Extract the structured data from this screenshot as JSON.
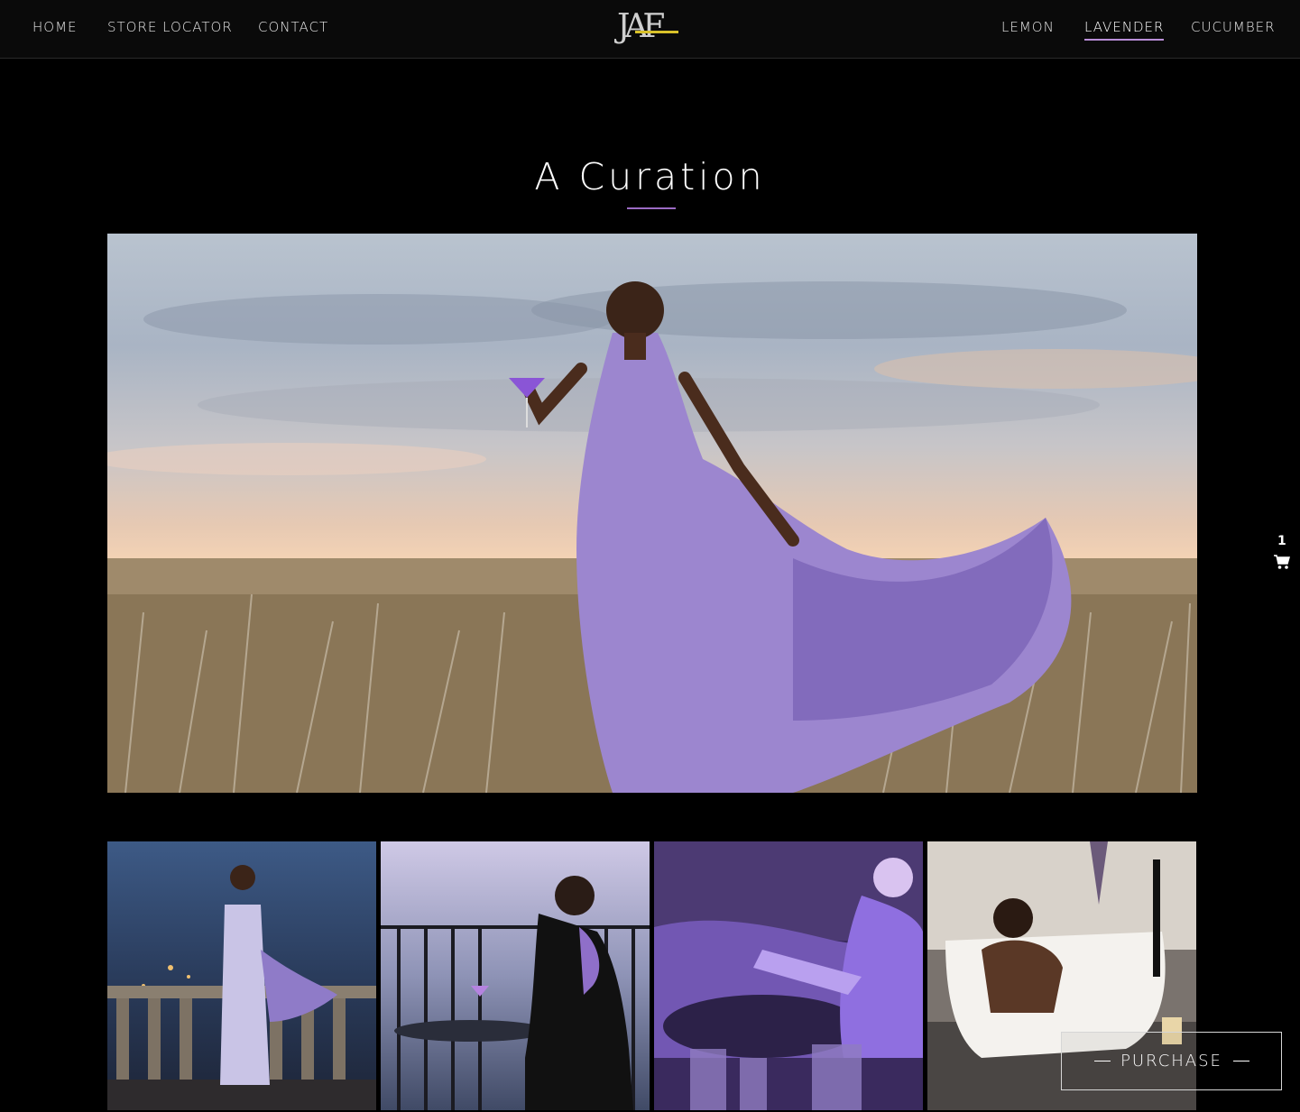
{
  "nav": {
    "left": [
      {
        "label": "HOME"
      },
      {
        "label": "STORE LOCATOR"
      },
      {
        "label": "CONTACT"
      }
    ],
    "right": [
      {
        "label": "LEMON"
      },
      {
        "label": "LAVENDER",
        "active": true
      },
      {
        "label": "CUCUMBER"
      }
    ],
    "logo": {
      "text": "JAF"
    }
  },
  "section": {
    "title": "A Curation"
  },
  "gallery": {
    "hero": {
      "description_icon": "hero-image"
    },
    "thumbnails": [
      {
        "icon": "thumbnail-image"
      },
      {
        "icon": "thumbnail-image"
      },
      {
        "icon": "thumbnail-image"
      },
      {
        "icon": "thumbnail-image"
      }
    ]
  },
  "cart": {
    "count": "1",
    "icon": "shopping-cart-icon"
  },
  "purchase": {
    "label": "PURCHASE"
  },
  "colors": {
    "background": "#000000",
    "nav_background": "#0a0a0a",
    "accent": "#b98ed8",
    "logo_accent": "#d8c12a"
  }
}
